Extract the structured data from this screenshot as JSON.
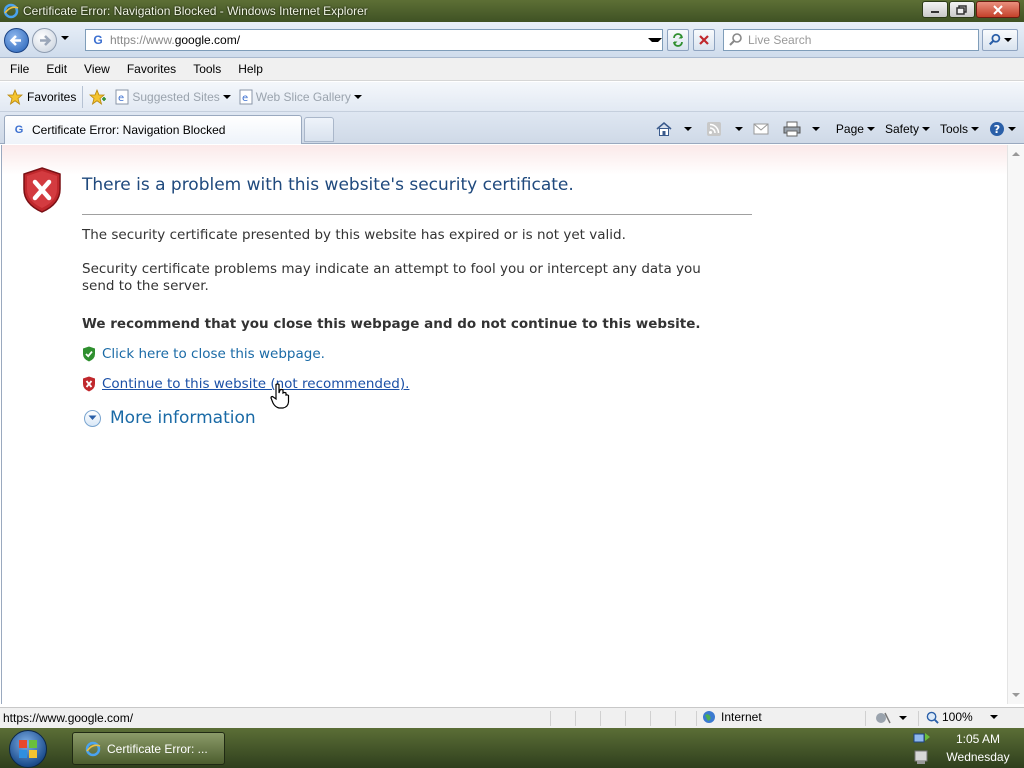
{
  "window": {
    "title": "Certificate Error: Navigation Blocked - Windows Internet Explorer"
  },
  "address_bar": {
    "url_prefix": "https://www.",
    "url_domain": "google.com/"
  },
  "search": {
    "placeholder": "Live Search"
  },
  "menu": {
    "items": [
      "File",
      "Edit",
      "View",
      "Favorites",
      "Tools",
      "Help"
    ]
  },
  "favorites_bar": {
    "favorites_label": "Favorites",
    "links": [
      "Suggested Sites",
      "Web Slice Gallery"
    ]
  },
  "tabs": {
    "active_label": "Certificate Error: Navigation Blocked"
  },
  "command_bar": {
    "page": "Page",
    "safety": "Safety",
    "tools": "Tools"
  },
  "error_page": {
    "title": "There is a problem with this website's security certificate.",
    "p1": "The security certificate presented by this website has expired or is not yet valid.",
    "p2": "Security certificate problems may indicate an attempt to fool you or intercept any data you send to the server.",
    "recommend": "We recommend that you close this webpage and do not continue to this website.",
    "close_link": "Click here to close this webpage.",
    "continue_link": "Continue to this website (not recommended).",
    "more_info": "More information"
  },
  "status_bar": {
    "url": "https://www.google.com/",
    "zone": "Internet",
    "zoom": "100%"
  },
  "taskbar": {
    "task_label": "Certificate Error: ...",
    "time": "1:05 AM",
    "day": "Wednesday"
  },
  "colors": {
    "accent_link": "#1a6aa6",
    "error_red": "#c0282d",
    "safe_green": "#2f8f2f",
    "title_blue": "#1f497d"
  },
  "icons": [
    "ie-logo-icon",
    "back-arrow-icon",
    "forward-arrow-icon",
    "google-favicon-icon",
    "refresh-icon",
    "stop-icon",
    "search-icon",
    "star-icon",
    "add-favorite-icon",
    "home-icon",
    "feeds-icon",
    "mail-icon",
    "print-icon",
    "help-icon",
    "shield-error-icon",
    "shield-ok-icon",
    "expand-circle-icon",
    "globe-icon",
    "hand-cursor-icon",
    "windows-orb-icon"
  ]
}
